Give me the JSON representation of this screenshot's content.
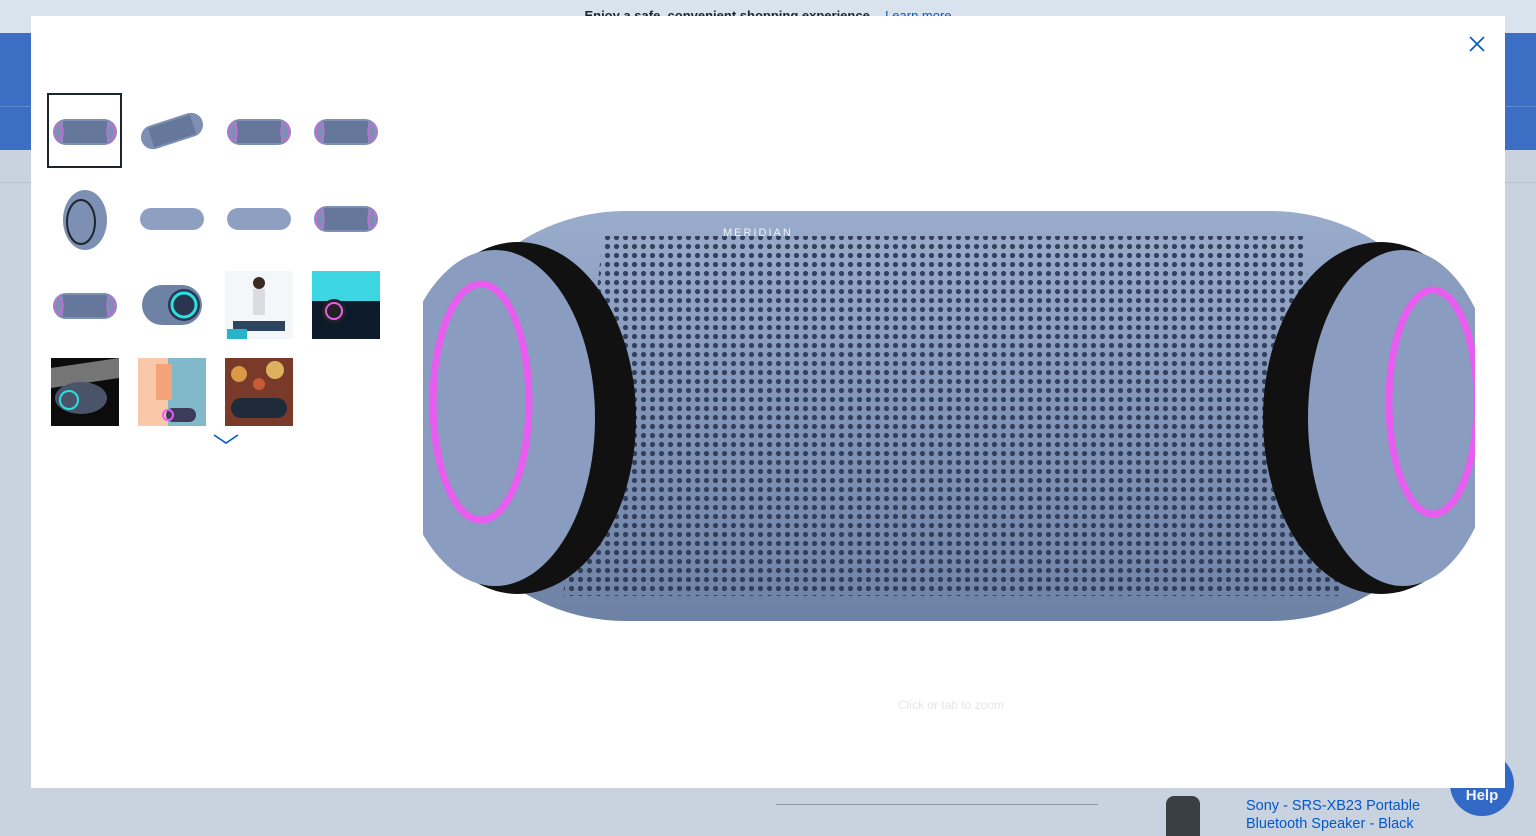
{
  "background": {
    "banner_text": "Enjoy a safe, convenient shopping experience.",
    "banner_link": "Learn more",
    "related_product": "Sony - SRS-XB23 Portable Bluetooth Speaker - Black",
    "help_label": "Help"
  },
  "modal": {
    "close_icon": "close-icon",
    "thumbnails": [
      {
        "label": "front-view",
        "kind": "speaker-front",
        "selected": true
      },
      {
        "label": "angled-view",
        "kind": "speaker-angled"
      },
      {
        "label": "front-view-2",
        "kind": "speaker-front"
      },
      {
        "label": "rear-view",
        "kind": "speaker-front"
      },
      {
        "label": "end-view",
        "kind": "speaker-end"
      },
      {
        "label": "top-view",
        "kind": "speaker-flat"
      },
      {
        "label": "bottom-view",
        "kind": "speaker-flat"
      },
      {
        "label": "front-view-3",
        "kind": "speaker-front"
      },
      {
        "label": "side-view",
        "kind": "speaker-front"
      },
      {
        "label": "light-ring-view",
        "kind": "speaker-ring"
      },
      {
        "label": "lifestyle-person",
        "kind": "lifestyle-light"
      },
      {
        "label": "lifestyle-neon",
        "kind": "lifestyle-teal"
      },
      {
        "label": "lifestyle-dark",
        "kind": "lifestyle-dark"
      },
      {
        "label": "lifestyle-party",
        "kind": "lifestyle-party"
      },
      {
        "label": "lifestyle-bokeh",
        "kind": "lifestyle-bokeh"
      }
    ],
    "main_image_brand_text": "MERIDIAN",
    "zoom_hint": "Click or tab to zoom",
    "colors": {
      "speaker_body": "#8094b8",
      "light_ring": "#e85cf0",
      "ring_teal": "#2ce0e0"
    }
  }
}
